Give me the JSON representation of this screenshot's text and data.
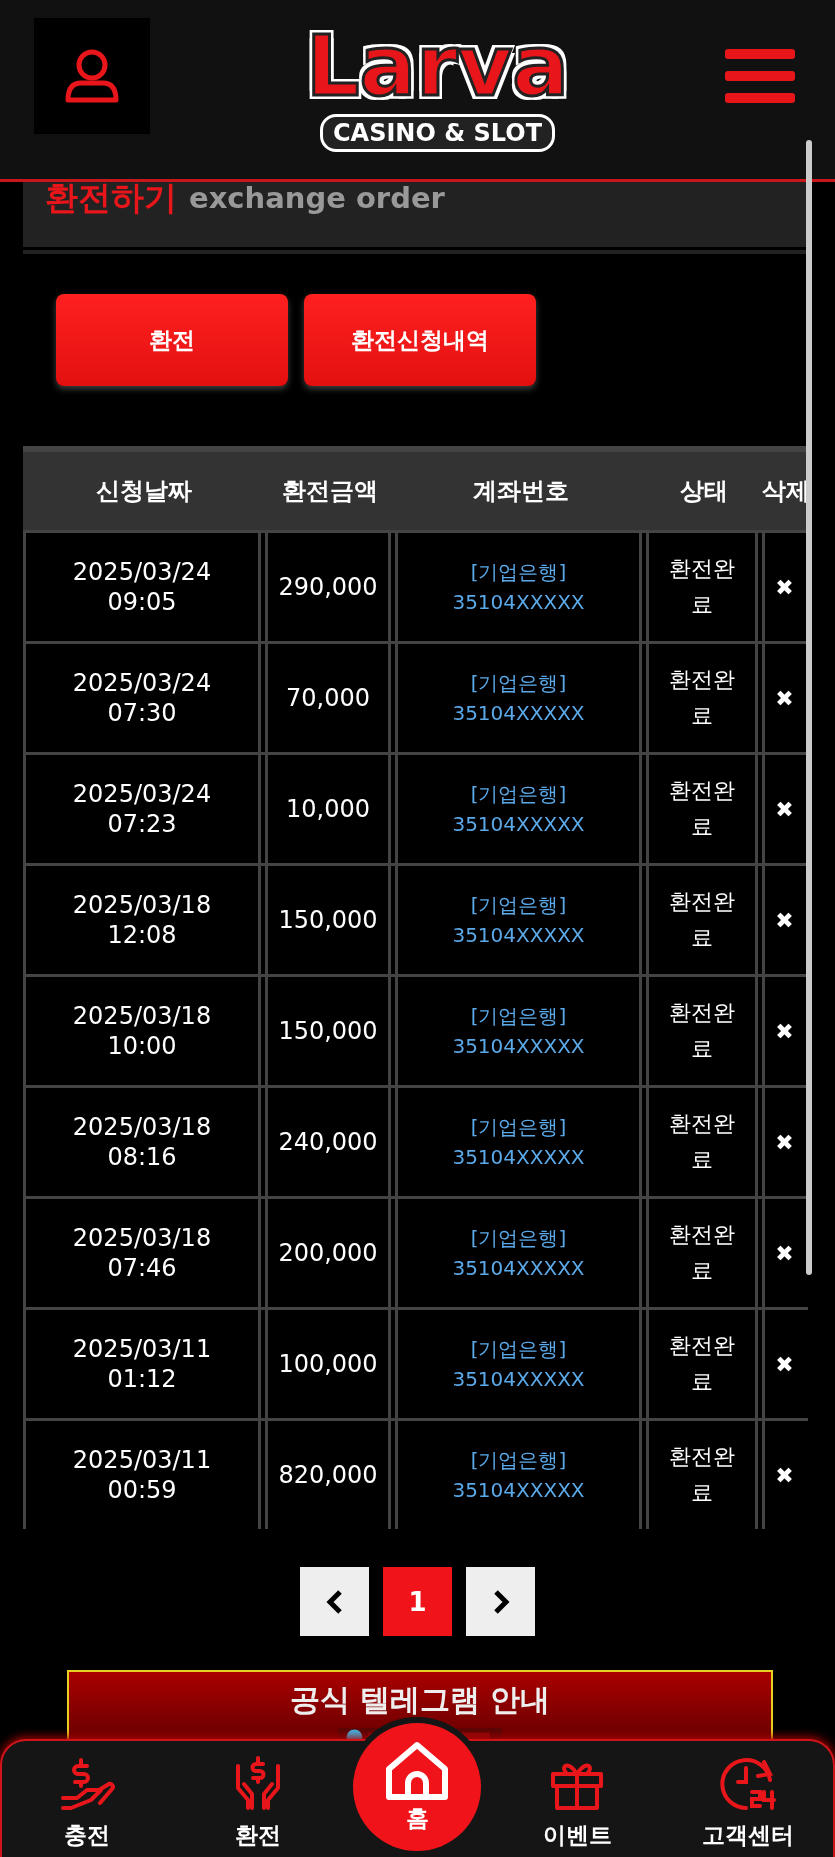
{
  "header": {
    "logo": {
      "name": "Larva",
      "tagline": "CASINO & SLOT"
    }
  },
  "section": {
    "title": "환전하기",
    "subtitle": "exchange order"
  },
  "buttons": [
    {
      "label": "환전"
    },
    {
      "label": "환전신청내역"
    }
  ],
  "table": {
    "columns": [
      "신청날짜",
      "환전금액",
      "계좌번호",
      "상태",
      "삭제"
    ],
    "rows": [
      {
        "date": "2025/03/24",
        "time": "09:05",
        "amount": "290,000",
        "bank": "[기업은행]",
        "account": "35104XXXXX",
        "status": "환전완료",
        "delete": "✖"
      },
      {
        "date": "2025/03/24",
        "time": "07:30",
        "amount": "70,000",
        "bank": "[기업은행]",
        "account": "35104XXXXX",
        "status": "환전완료",
        "delete": "✖"
      },
      {
        "date": "2025/03/24",
        "time": "07:23",
        "amount": "10,000",
        "bank": "[기업은행]",
        "account": "35104XXXXX",
        "status": "환전완료",
        "delete": "✖"
      },
      {
        "date": "2025/03/18",
        "time": "12:08",
        "amount": "150,000",
        "bank": "[기업은행]",
        "account": "35104XXXXX",
        "status": "환전완료",
        "delete": "✖"
      },
      {
        "date": "2025/03/18",
        "time": "10:00",
        "amount": "150,000",
        "bank": "[기업은행]",
        "account": "35104XXXXX",
        "status": "환전완료",
        "delete": "✖"
      },
      {
        "date": "2025/03/18",
        "time": "08:16",
        "amount": "240,000",
        "bank": "[기업은행]",
        "account": "35104XXXXX",
        "status": "환전완료",
        "delete": "✖"
      },
      {
        "date": "2025/03/18",
        "time": "07:46",
        "amount": "200,000",
        "bank": "[기업은행]",
        "account": "35104XXXXX",
        "status": "환전완료",
        "delete": "✖"
      },
      {
        "date": "2025/03/11",
        "time": "01:12",
        "amount": "100,000",
        "bank": "[기업은행]",
        "account": "35104XXXXX",
        "status": "환전완료",
        "delete": "✖"
      },
      {
        "date": "2025/03/11",
        "time": "00:59",
        "amount": "820,000",
        "bank": "[기업은행]",
        "account": "35104XXXXX",
        "status": "환전완료",
        "delete": "✖"
      }
    ]
  },
  "pagination": {
    "pages": [
      {
        "label": "1",
        "selected": true
      }
    ]
  },
  "banner": {
    "title": "공식 텔레그램 안내"
  },
  "bottom_nav": [
    {
      "label": "충전",
      "kind": "deposit",
      "selected": false
    },
    {
      "label": "환전",
      "kind": "withdraw",
      "selected": false
    },
    {
      "label": "홈",
      "kind": "home",
      "selected": true
    },
    {
      "label": "이벤트",
      "kind": "gift",
      "selected": false
    },
    {
      "label": "고객센터",
      "kind": "support",
      "selected": false
    }
  ]
}
